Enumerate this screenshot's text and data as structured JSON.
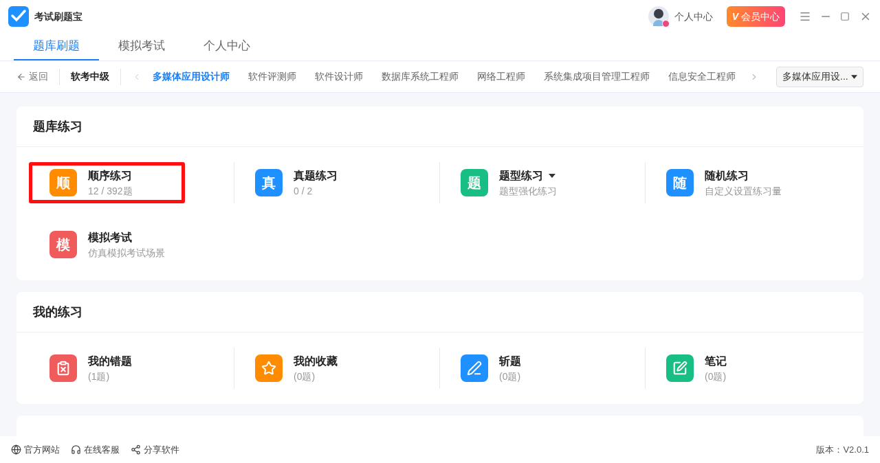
{
  "app": {
    "title": "考试刷题宝",
    "user_label": "个人中心",
    "vip_button": "会员中心",
    "vip_mark": "V"
  },
  "tabs": [
    {
      "label": "题库刷题",
      "selected": true
    },
    {
      "label": "模拟考试",
      "selected": false
    },
    {
      "label": "个人中心",
      "selected": false
    }
  ],
  "subnav": {
    "back": "返回",
    "level": "软考中级",
    "dropdown": "多媒体应用设...",
    "categories": [
      {
        "label": "多媒体应用设计师",
        "selected": true
      },
      {
        "label": "软件评测师",
        "selected": false
      },
      {
        "label": "软件设计师",
        "selected": false
      },
      {
        "label": "数据库系统工程师",
        "selected": false
      },
      {
        "label": "网络工程师",
        "selected": false
      },
      {
        "label": "系统集成项目管理工程师",
        "selected": false
      },
      {
        "label": "信息安全工程师",
        "selected": false
      }
    ]
  },
  "sections": [
    {
      "title": "题库练习",
      "items": [
        {
          "kind": "letter",
          "glyph": "顺",
          "color": "#ff8c00",
          "title": "顺序练习",
          "subtitle": "12 / 392题",
          "highlighted": true,
          "has_dropdown": false
        },
        {
          "kind": "letter",
          "glyph": "真",
          "color": "#1e90ff",
          "title": "真题练习",
          "subtitle": "0 / 2",
          "highlighted": false,
          "has_dropdown": false
        },
        {
          "kind": "letter",
          "glyph": "题",
          "color": "#19be84",
          "title": "题型练习",
          "subtitle": "题型强化练习",
          "highlighted": false,
          "has_dropdown": true
        },
        {
          "kind": "letter",
          "glyph": "随",
          "color": "#1e90ff",
          "title": "随机练习",
          "subtitle": "自定义设置练习量",
          "highlighted": false,
          "has_dropdown": false
        },
        {
          "kind": "letter",
          "glyph": "模",
          "color": "#f05b5b",
          "title": "模拟考试",
          "subtitle": "仿真模拟考试场景",
          "highlighted": false,
          "has_dropdown": false
        }
      ]
    },
    {
      "title": "我的练习",
      "items": [
        {
          "kind": "clipboard",
          "color": "#f05b5b",
          "title": "我的错题",
          "subtitle": "(1题)",
          "highlighted": false,
          "has_dropdown": false
        },
        {
          "kind": "star",
          "color": "#ff8c00",
          "title": "我的收藏",
          "subtitle": "(0题)",
          "highlighted": false,
          "has_dropdown": false
        },
        {
          "kind": "pen",
          "color": "#1e90ff",
          "title": "斩题",
          "subtitle": "(0题)",
          "highlighted": false,
          "has_dropdown": false
        },
        {
          "kind": "note",
          "color": "#19be84",
          "title": "笔记",
          "subtitle": "(0题)",
          "highlighted": false,
          "has_dropdown": false
        }
      ]
    }
  ],
  "footer": {
    "links": [
      "官方网站",
      "在线客服",
      "分享软件"
    ],
    "version": "版本：V2.0.1"
  }
}
